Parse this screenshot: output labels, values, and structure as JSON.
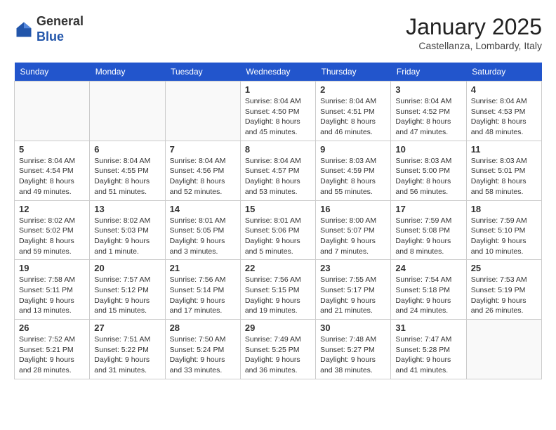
{
  "header": {
    "logo_general": "General",
    "logo_blue": "Blue",
    "month_title": "January 2025",
    "location": "Castellanza, Lombardy, Italy"
  },
  "days_of_week": [
    "Sunday",
    "Monday",
    "Tuesday",
    "Wednesday",
    "Thursday",
    "Friday",
    "Saturday"
  ],
  "weeks": [
    [
      {
        "day": "",
        "info": ""
      },
      {
        "day": "",
        "info": ""
      },
      {
        "day": "",
        "info": ""
      },
      {
        "day": "1",
        "info": "Sunrise: 8:04 AM\nSunset: 4:50 PM\nDaylight: 8 hours\nand 45 minutes."
      },
      {
        "day": "2",
        "info": "Sunrise: 8:04 AM\nSunset: 4:51 PM\nDaylight: 8 hours\nand 46 minutes."
      },
      {
        "day": "3",
        "info": "Sunrise: 8:04 AM\nSunset: 4:52 PM\nDaylight: 8 hours\nand 47 minutes."
      },
      {
        "day": "4",
        "info": "Sunrise: 8:04 AM\nSunset: 4:53 PM\nDaylight: 8 hours\nand 48 minutes."
      }
    ],
    [
      {
        "day": "5",
        "info": "Sunrise: 8:04 AM\nSunset: 4:54 PM\nDaylight: 8 hours\nand 49 minutes."
      },
      {
        "day": "6",
        "info": "Sunrise: 8:04 AM\nSunset: 4:55 PM\nDaylight: 8 hours\nand 51 minutes."
      },
      {
        "day": "7",
        "info": "Sunrise: 8:04 AM\nSunset: 4:56 PM\nDaylight: 8 hours\nand 52 minutes."
      },
      {
        "day": "8",
        "info": "Sunrise: 8:04 AM\nSunset: 4:57 PM\nDaylight: 8 hours\nand 53 minutes."
      },
      {
        "day": "9",
        "info": "Sunrise: 8:03 AM\nSunset: 4:59 PM\nDaylight: 8 hours\nand 55 minutes."
      },
      {
        "day": "10",
        "info": "Sunrise: 8:03 AM\nSunset: 5:00 PM\nDaylight: 8 hours\nand 56 minutes."
      },
      {
        "day": "11",
        "info": "Sunrise: 8:03 AM\nSunset: 5:01 PM\nDaylight: 8 hours\nand 58 minutes."
      }
    ],
    [
      {
        "day": "12",
        "info": "Sunrise: 8:02 AM\nSunset: 5:02 PM\nDaylight: 8 hours\nand 59 minutes."
      },
      {
        "day": "13",
        "info": "Sunrise: 8:02 AM\nSunset: 5:03 PM\nDaylight: 9 hours\nand 1 minute."
      },
      {
        "day": "14",
        "info": "Sunrise: 8:01 AM\nSunset: 5:05 PM\nDaylight: 9 hours\nand 3 minutes."
      },
      {
        "day": "15",
        "info": "Sunrise: 8:01 AM\nSunset: 5:06 PM\nDaylight: 9 hours\nand 5 minutes."
      },
      {
        "day": "16",
        "info": "Sunrise: 8:00 AM\nSunset: 5:07 PM\nDaylight: 9 hours\nand 7 minutes."
      },
      {
        "day": "17",
        "info": "Sunrise: 7:59 AM\nSunset: 5:08 PM\nDaylight: 9 hours\nand 8 minutes."
      },
      {
        "day": "18",
        "info": "Sunrise: 7:59 AM\nSunset: 5:10 PM\nDaylight: 9 hours\nand 10 minutes."
      }
    ],
    [
      {
        "day": "19",
        "info": "Sunrise: 7:58 AM\nSunset: 5:11 PM\nDaylight: 9 hours\nand 13 minutes."
      },
      {
        "day": "20",
        "info": "Sunrise: 7:57 AM\nSunset: 5:12 PM\nDaylight: 9 hours\nand 15 minutes."
      },
      {
        "day": "21",
        "info": "Sunrise: 7:56 AM\nSunset: 5:14 PM\nDaylight: 9 hours\nand 17 minutes."
      },
      {
        "day": "22",
        "info": "Sunrise: 7:56 AM\nSunset: 5:15 PM\nDaylight: 9 hours\nand 19 minutes."
      },
      {
        "day": "23",
        "info": "Sunrise: 7:55 AM\nSunset: 5:17 PM\nDaylight: 9 hours\nand 21 minutes."
      },
      {
        "day": "24",
        "info": "Sunrise: 7:54 AM\nSunset: 5:18 PM\nDaylight: 9 hours\nand 24 minutes."
      },
      {
        "day": "25",
        "info": "Sunrise: 7:53 AM\nSunset: 5:19 PM\nDaylight: 9 hours\nand 26 minutes."
      }
    ],
    [
      {
        "day": "26",
        "info": "Sunrise: 7:52 AM\nSunset: 5:21 PM\nDaylight: 9 hours\nand 28 minutes."
      },
      {
        "day": "27",
        "info": "Sunrise: 7:51 AM\nSunset: 5:22 PM\nDaylight: 9 hours\nand 31 minutes."
      },
      {
        "day": "28",
        "info": "Sunrise: 7:50 AM\nSunset: 5:24 PM\nDaylight: 9 hours\nand 33 minutes."
      },
      {
        "day": "29",
        "info": "Sunrise: 7:49 AM\nSunset: 5:25 PM\nDaylight: 9 hours\nand 36 minutes."
      },
      {
        "day": "30",
        "info": "Sunrise: 7:48 AM\nSunset: 5:27 PM\nDaylight: 9 hours\nand 38 minutes."
      },
      {
        "day": "31",
        "info": "Sunrise: 7:47 AM\nSunset: 5:28 PM\nDaylight: 9 hours\nand 41 minutes."
      },
      {
        "day": "",
        "info": ""
      }
    ]
  ]
}
